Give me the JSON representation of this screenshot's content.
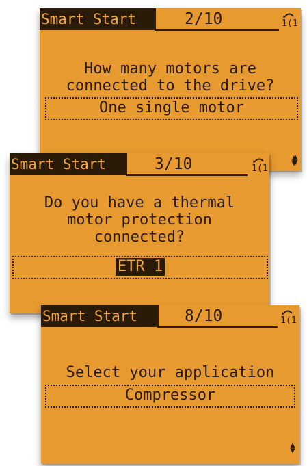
{
  "screens": [
    {
      "title": "Smart Start",
      "step": "2/10",
      "question_lines": [
        "How many motors are",
        "connected to the drive?"
      ],
      "answer": "One single motor",
      "icon": "menu-tree-icon",
      "scroll": "up-down-arrows"
    },
    {
      "title": "Smart Start",
      "step": "3/10",
      "question_lines": [
        "Do you have a thermal",
        "motor protection",
        "connected?"
      ],
      "answer": "ETR 1",
      "icon": "menu-tree-icon",
      "scroll": "up-down-arrows"
    },
    {
      "title": "Smart Start",
      "step": "8/10",
      "question_lines": [
        "Select your application"
      ],
      "answer": "Compressor",
      "icon": "menu-tree-icon",
      "scroll": "up-down-arrows"
    }
  ],
  "colors": {
    "screen_bg": "#e79a30",
    "text_dark": "#2a1a08",
    "title_text": "#f1a83c"
  }
}
